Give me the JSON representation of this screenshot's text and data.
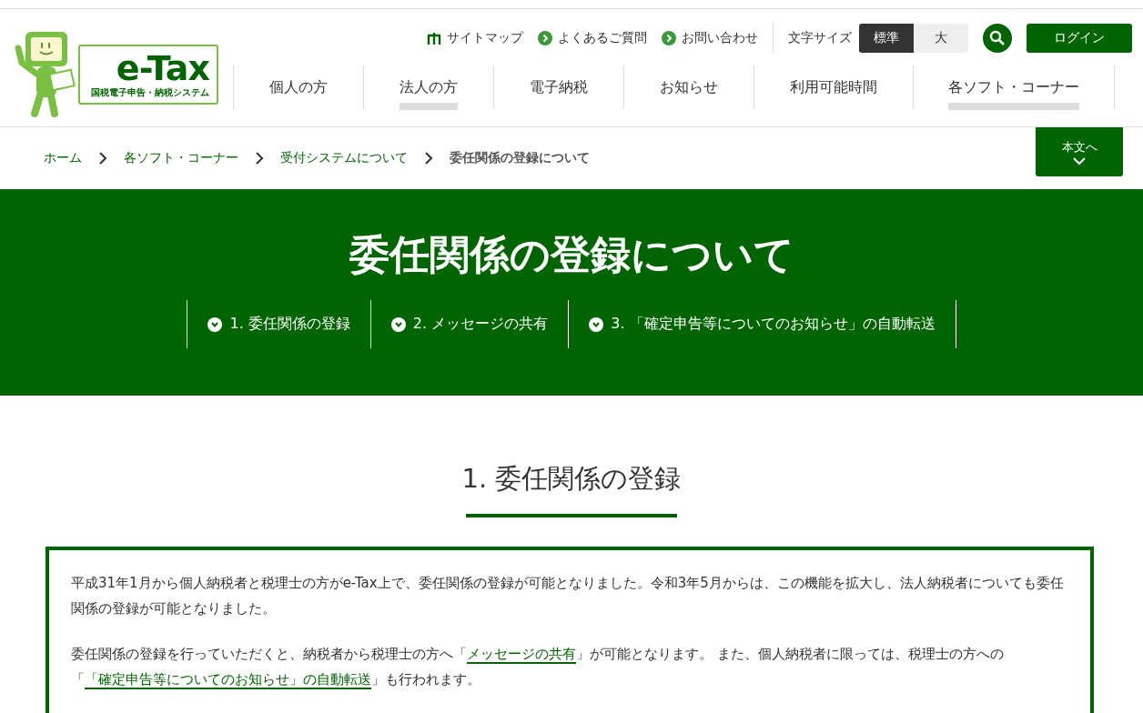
{
  "logo": {
    "title": "e-Tax",
    "subtitle": "国税電子申告・納税システム"
  },
  "utility_links": [
    {
      "kind": "sitemap",
      "label": "サイトマップ"
    },
    {
      "kind": "arrow",
      "label": "よくあるご質問"
    },
    {
      "kind": "arrow",
      "label": "お問い合わせ"
    }
  ],
  "font_size": {
    "label": "文字サイズ",
    "options": [
      {
        "label": "標準",
        "selected": true
      },
      {
        "label": "大",
        "selected": false
      }
    ]
  },
  "login_button": "ログイン",
  "nav": [
    {
      "label": "個人の方",
      "underlined": false
    },
    {
      "label": "法人の方",
      "underlined": true
    },
    {
      "label": "電子納税",
      "underlined": false
    },
    {
      "label": "お知らせ",
      "underlined": false
    },
    {
      "label": "利用可能時間",
      "underlined": false
    },
    {
      "label": "各ソフト・コーナー",
      "underlined": true
    }
  ],
  "breadcrumb": [
    {
      "label": "ホーム",
      "current": false
    },
    {
      "label": "各ソフト・コーナー",
      "current": false
    },
    {
      "label": "受付システムについて",
      "current": false
    },
    {
      "label": "委任関係の登録について",
      "current": true
    }
  ],
  "skip_button": "本文へ",
  "page_title": "委任関係の登録について",
  "anchors": [
    "1. 委任関係の登録",
    "2. メッセージの共有",
    "3. 「確定申告等についてのお知らせ」の自動転送"
  ],
  "section": {
    "heading": "1. 委任関係の登録",
    "paragraphs": [
      [
        {
          "kind": "text",
          "text": "平成31年1月から個人納税者と税理士の方がe-Tax上で、委任関係の登録が可能となりました。令和3年5月からは、この機能を拡大し、法人納税者についても委任関係の登録が可能となりました。"
        }
      ],
      [
        {
          "kind": "text",
          "text": "委任関係の登録を行っていただくと、納税者から税理士の方へ「"
        },
        {
          "kind": "link",
          "text": "メッセージの共有"
        },
        {
          "kind": "text",
          "text": "」が可能となります。 また、個人納税者に限っては、税理士の方への「"
        },
        {
          "kind": "link",
          "text": "「確定申告等についてのお知らせ」の自動転送"
        },
        {
          "kind": "text",
          "text": "」も行われます。"
        }
      ]
    ]
  }
}
